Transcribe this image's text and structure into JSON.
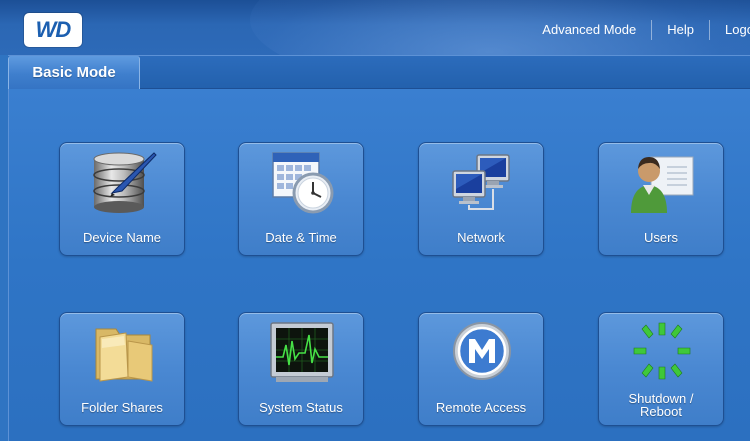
{
  "header": {
    "logo_text": "WD",
    "nav": [
      {
        "label": "Advanced Mode"
      },
      {
        "label": "Help"
      },
      {
        "label": "Logout"
      }
    ]
  },
  "tabs": {
    "active_label": "Basic Mode"
  },
  "tiles": [
    {
      "label": "Device Name",
      "icon": "database-pen-icon"
    },
    {
      "label": "Date & Time",
      "icon": "calendar-clock-icon"
    },
    {
      "label": "Network",
      "icon": "network-computers-icon"
    },
    {
      "label": "Users",
      "icon": "user-card-icon"
    },
    {
      "label": "Folder Shares",
      "icon": "folder-icon"
    },
    {
      "label": "System Status",
      "icon": "monitor-status-icon"
    },
    {
      "label": "Remote Access",
      "icon": "remote-access-m-icon"
    },
    {
      "label_line1": "Shutdown /",
      "label_line2": "Reboot",
      "icon": "shutdown-spinner-icon"
    }
  ],
  "colors": {
    "background": "#2f74c2",
    "tile": "#4a88d2",
    "text": "#ffffff",
    "logo_text": "#1c5fb0",
    "status_green": "#3fc83a"
  }
}
